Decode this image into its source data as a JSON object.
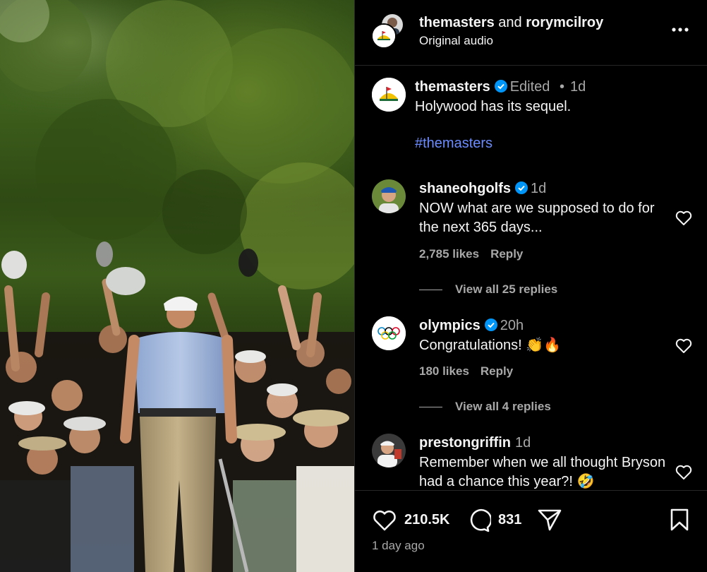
{
  "header": {
    "user_primary": "themasters",
    "joiner": "and",
    "user_secondary": "rorymcilroy",
    "subtitle": "Original audio"
  },
  "caption": {
    "username": "themasters",
    "edited": "Edited",
    "dot": "•",
    "time": "1d",
    "text": "Holywood has its sequel.",
    "hashtag": "#themasters"
  },
  "comments": [
    {
      "username": "shaneohgolfs",
      "time": "1d",
      "text": "NOW what are we supposed to do for the next 365 days...",
      "likes": "2,785 likes",
      "reply": "Reply",
      "view_replies": "View all 25 replies"
    },
    {
      "username": "olympics",
      "time": "20h",
      "text": "Congratulations! 👏🔥",
      "likes": "180 likes",
      "reply": "Reply",
      "view_replies": "View all 4 replies"
    },
    {
      "username": "prestongriffin",
      "time": "1d",
      "text": "Remember when we all thought Bryson had a chance this year?! 🤣"
    }
  ],
  "footer": {
    "likes": "210.5K",
    "comments": "831",
    "posted": "1 day ago"
  },
  "icons": {
    "verified_color": "#0095f6",
    "hashtag_color": "#6b8cff"
  }
}
